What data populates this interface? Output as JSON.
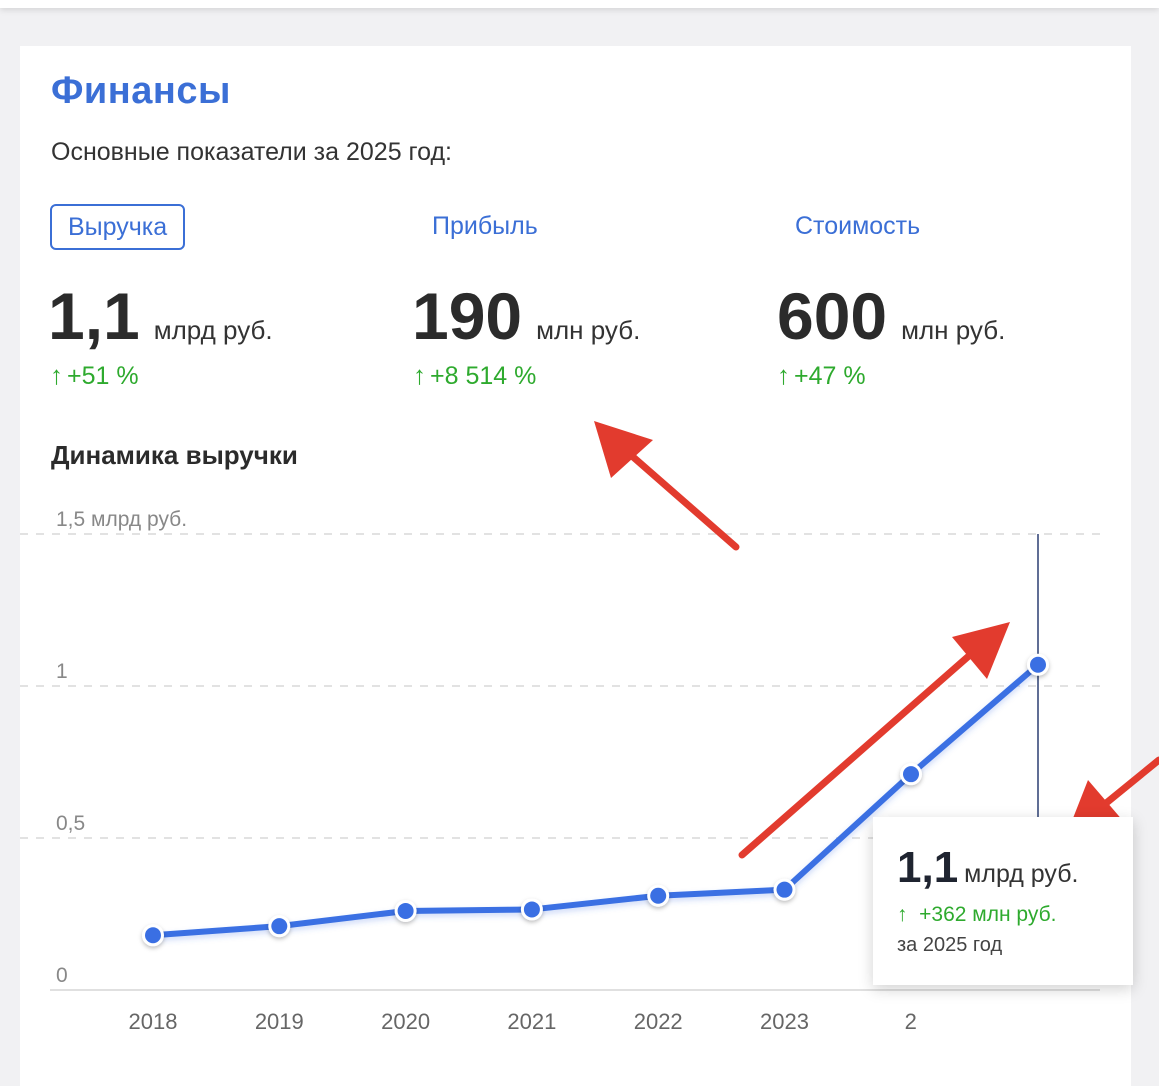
{
  "header": {
    "title": "Финансы",
    "subtitle": "Основные показатели за 2025 год:"
  },
  "tabs": [
    {
      "label": "Выручка",
      "active": true
    },
    {
      "label": "Прибыль",
      "active": false
    },
    {
      "label": "Стоимость",
      "active": false
    }
  ],
  "metrics": [
    {
      "value": "1,1",
      "unit": "млрд руб.",
      "change": "+51 %"
    },
    {
      "value": "190",
      "unit": "млн руб.",
      "change": "+8 514 %"
    },
    {
      "value": "600",
      "unit": "млн руб.",
      "change": "+47 %"
    }
  ],
  "chart_section": {
    "title": "Динамика выручки"
  },
  "tooltip": {
    "value": "1,1",
    "unit": "млрд руб.",
    "change": "+362 млн руб.",
    "period": "за 2025 год"
  },
  "colors": {
    "accent": "#3b6fd6",
    "line": "#3a6fe3",
    "positive": "#2eaa2e",
    "annotation": "#e23b2e"
  },
  "icons": {
    "up_arrow": "arrow-up-icon"
  },
  "chart_data": {
    "type": "line",
    "title": "Динамика выручки",
    "categories": [
      "2018",
      "2019",
      "2020",
      "2021",
      "2022",
      "2023",
      "2024",
      "2025"
    ],
    "x_tick_labels": [
      "2018",
      "2019",
      "2020",
      "2021",
      "2022",
      "2023",
      "2"
    ],
    "series": [
      {
        "values": [
          0.18,
          0.21,
          0.26,
          0.265,
          0.31,
          0.33,
          0.71,
          1.07
        ]
      }
    ],
    "ylim": [
      0,
      1.5
    ],
    "y_ticks": [
      0,
      0.5,
      1,
      1.5
    ],
    "y_tick_labels": [
      "0",
      "0,5",
      "1",
      "1,5 млрд руб."
    ],
    "grid": true,
    "highlight_index": 7
  }
}
